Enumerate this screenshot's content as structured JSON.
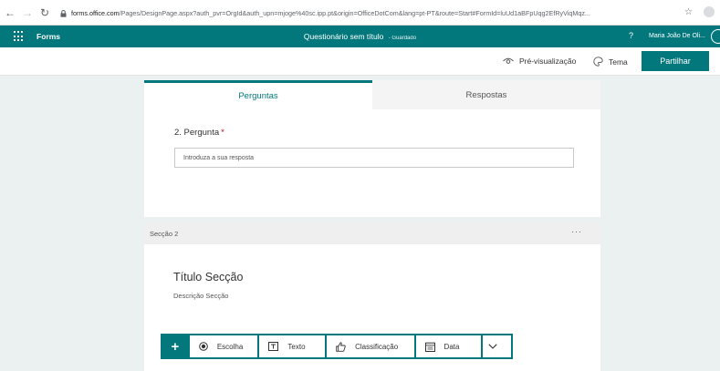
{
  "browser": {
    "url_host": "forms.office.com",
    "url_rest": "/Pages/DesignPage.aspx?auth_pvr=OrgId&auth_upn=mjoge%40sc.ipp.pt&origin=OfficeDotCom&lang=pt-PT&route=Start#FormId=luUd1aBFpUqg2EfRyViqMqz..."
  },
  "header": {
    "app_name": "Forms",
    "doc_title": "Questionário sem título",
    "doc_status": "- Guardado",
    "help": "?",
    "user_name": "Maria João De Oli..."
  },
  "toolbar": {
    "preview_label": "Pré-visualização",
    "theme_label": "Tema",
    "share_label": "Partilhar"
  },
  "tabs": [
    {
      "label": "Perguntas",
      "active": true
    },
    {
      "label": "Respostas",
      "active": false
    }
  ],
  "question": {
    "label": "2. Pergunta",
    "required_mark": "*",
    "answer_placeholder": "Introduza a sua resposta"
  },
  "section": {
    "header_label": "Secção 2",
    "more": "···",
    "title": "Título Secção",
    "description": "Descrição Secção"
  },
  "add_bar": {
    "plus": "+",
    "options": [
      "Escolha",
      "Texto",
      "Classificação",
      "Data"
    ]
  },
  "colors": {
    "accent": "#03787c",
    "background": "#eaf1f0",
    "required": "#c50f1f"
  }
}
